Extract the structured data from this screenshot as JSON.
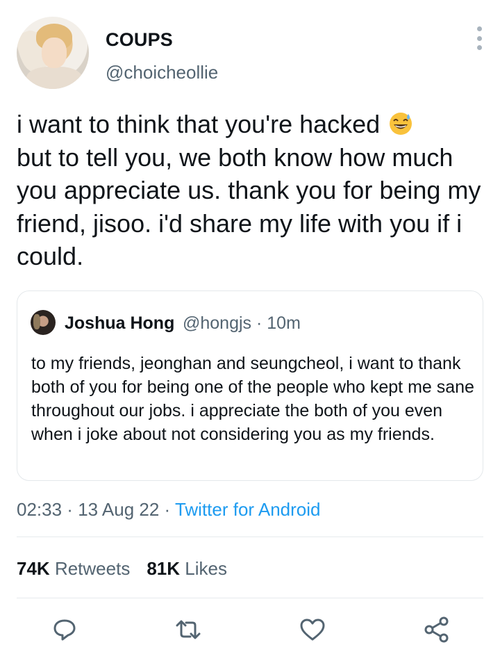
{
  "tweet": {
    "display_name": "COUPS",
    "handle": "@choicheollie",
    "text": "i want to think that you're hacked",
    "text_cont": "but to tell you, we both know how much you appreciate us. thank you for being my friend, jisoo. i'd share my life with you if i could.",
    "emoji": "grinning-sweat-emoji"
  },
  "quote": {
    "display_name": "Joshua Hong",
    "meta": "@hongjs · 10m",
    "text": "to my friends, jeonghan and seungcheol, i want to thank both of you for being one of the people who kept me sane throughout our jobs. i appreciate the both of you even when i joke about not considering you as my friends."
  },
  "meta": {
    "time": "02:33",
    "sep1": " · ",
    "date": "13 Aug 22",
    "sep2": " · ",
    "client": "Twitter for Android"
  },
  "stats": {
    "retweets_count": "74K",
    "retweets_label": "Retweets",
    "likes_count": "81K",
    "likes_label": "Likes"
  },
  "actions": {
    "reply_icon": "reply-icon",
    "retweet_icon": "retweet-icon",
    "like_icon": "heart-icon",
    "share_icon": "share-icon"
  },
  "colors": {
    "text": "#0f1419",
    "secondary": "#536471",
    "link": "#1d9bf0",
    "border": "#e4e8eb"
  }
}
